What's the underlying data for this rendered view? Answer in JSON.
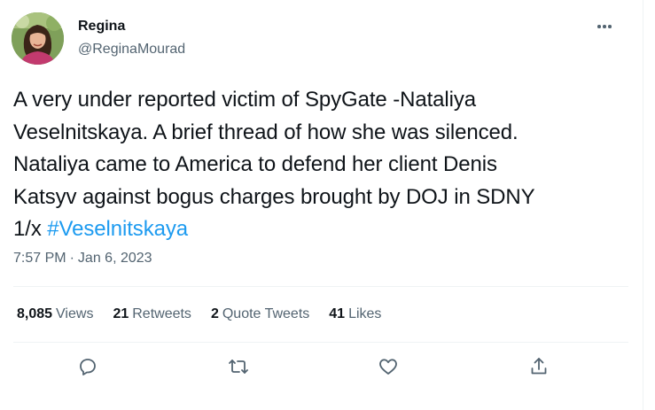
{
  "author": {
    "name": "Regina",
    "handle": "@ReginaMourad"
  },
  "tweet": {
    "lines": [
      "A very under reported victim of SpyGate -Nataliya",
      "Veselnitskaya. A brief thread of how she was silenced.",
      "Nataliya came to America to defend her client Denis",
      "Katsyv against bogus charges brought by DOJ in SDNY"
    ],
    "last_line_prefix": "1/x ",
    "hashtag": "#Veselnitskaya",
    "time": "7:57 PM",
    "separator": "·",
    "date": "Jan 6, 2023"
  },
  "stats": {
    "views_count": "8,085",
    "views_label": "Views",
    "retweets_count": "21",
    "retweets_label": "Retweets",
    "quotes_count": "2",
    "quotes_label": "Quote Tweets",
    "likes_count": "41",
    "likes_label": "Likes"
  },
  "icons": {
    "more": "more-horizontal-icon",
    "reply": "reply-icon",
    "retweet": "retweet-icon",
    "like": "heart-icon",
    "share": "share-icon"
  },
  "colors": {
    "text": "#0f1419",
    "secondary": "#536471",
    "link": "#1d9bf0",
    "divider": "#eff3f4"
  }
}
